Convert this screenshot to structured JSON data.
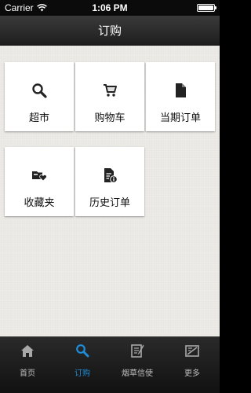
{
  "status_bar": {
    "carrier": "Carrier",
    "time": "1:06 PM",
    "battery_level": 1.0
  },
  "nav": {
    "title": "订购"
  },
  "tiles": [
    {
      "label": "超市",
      "icon": "search-icon"
    },
    {
      "label": "购物车",
      "icon": "cart-icon"
    },
    {
      "label": "当期订单",
      "icon": "document-icon"
    },
    {
      "label": "收藏夹",
      "icon": "favorites-folder-icon"
    },
    {
      "label": "历史订单",
      "icon": "order-history-icon"
    }
  ],
  "tab_bar": {
    "tabs": [
      {
        "label": "首页",
        "icon": "home-icon",
        "active": false
      },
      {
        "label": "订购",
        "icon": "search-icon",
        "active": true
      },
      {
        "label": "烟草信使",
        "icon": "note-icon",
        "active": false
      },
      {
        "label": "更多",
        "icon": "more-icon",
        "active": false
      }
    ]
  },
  "colors": {
    "accent": "#1e8ed9",
    "background": "#ecebe6",
    "bar": "#1e1e1e"
  }
}
